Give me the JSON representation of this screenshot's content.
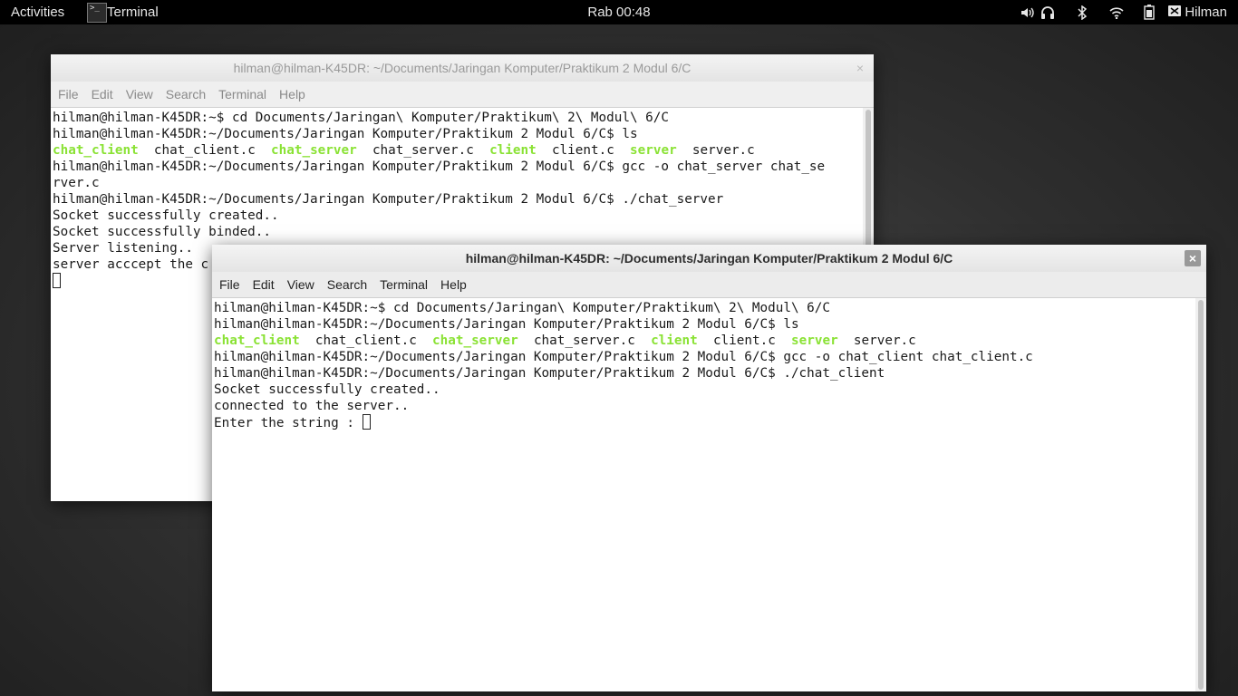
{
  "topbar": {
    "activities": "Activities",
    "app_name": "Terminal",
    "app_icon_glyph": ">_",
    "clock": "Rab 00:48",
    "user": "Hilman",
    "tray_icons": [
      "volume-icon",
      "headphones-icon",
      "bluetooth-icon",
      "wifi-icon",
      "battery-icon",
      "user-icon"
    ]
  },
  "back_window": {
    "title": "hilman@hilman-K45DR: ~/Documents/Jaringan Komputer/Praktikum 2 Modul 6/C",
    "close": "×",
    "menu": [
      "File",
      "Edit",
      "View",
      "Search",
      "Terminal",
      "Help"
    ],
    "lines": [
      "hilman@hilman-K45DR:~$ cd Documents/Jaringan\\ Komputer/Praktikum\\ 2\\ Modul\\ 6/C",
      "hilman@hilman-K45DR:~/Documents/Jaringan Komputer/Praktikum 2 Modul 6/C$ ls",
      "",
      "hilman@hilman-K45DR:~/Documents/Jaringan Komputer/Praktikum 2 Modul 6/C$ gcc -o chat_server chat_se",
      "rver.c",
      "hilman@hilman-K45DR:~/Documents/Jaringan Komputer/Praktikum 2 Modul 6/C$ ./chat_server",
      "Socket successfully created..",
      "Socket successfully binded..",
      "Server listening..",
      "server acccept the c"
    ],
    "ls": {
      "exec1": "chat_client",
      "file1": "chat_client.c",
      "exec2": "chat_server",
      "file2": "chat_server.c",
      "exec3": "client",
      "file3": "client.c",
      "exec4": "server",
      "file4": "server.c"
    }
  },
  "front_window": {
    "title": "hilman@hilman-K45DR: ~/Documents/Jaringan Komputer/Praktikum 2 Modul 6/C",
    "close": "×",
    "menu": [
      "File",
      "Edit",
      "View",
      "Search",
      "Terminal",
      "Help"
    ],
    "lines": [
      "hilman@hilman-K45DR:~$ cd Documents/Jaringan\\ Komputer/Praktikum\\ 2\\ Modul\\ 6/C",
      "hilman@hilman-K45DR:~/Documents/Jaringan Komputer/Praktikum 2 Modul 6/C$ ls",
      "",
      "hilman@hilman-K45DR:~/Documents/Jaringan Komputer/Praktikum 2 Modul 6/C$ gcc -o chat_client chat_client.c",
      "hilman@hilman-K45DR:~/Documents/Jaringan Komputer/Praktikum 2 Modul 6/C$ ./chat_client",
      "Socket successfully created..",
      "connected to the server..",
      "Enter the string : "
    ],
    "ls": {
      "exec1": "chat_client",
      "file1": "chat_client.c",
      "exec2": "chat_server",
      "file2": "chat_server.c",
      "exec3": "client",
      "file3": "client.c",
      "exec4": "server",
      "file4": "server.c"
    }
  },
  "colors": {
    "executable": "#8ae234",
    "topbar": "#000000"
  }
}
